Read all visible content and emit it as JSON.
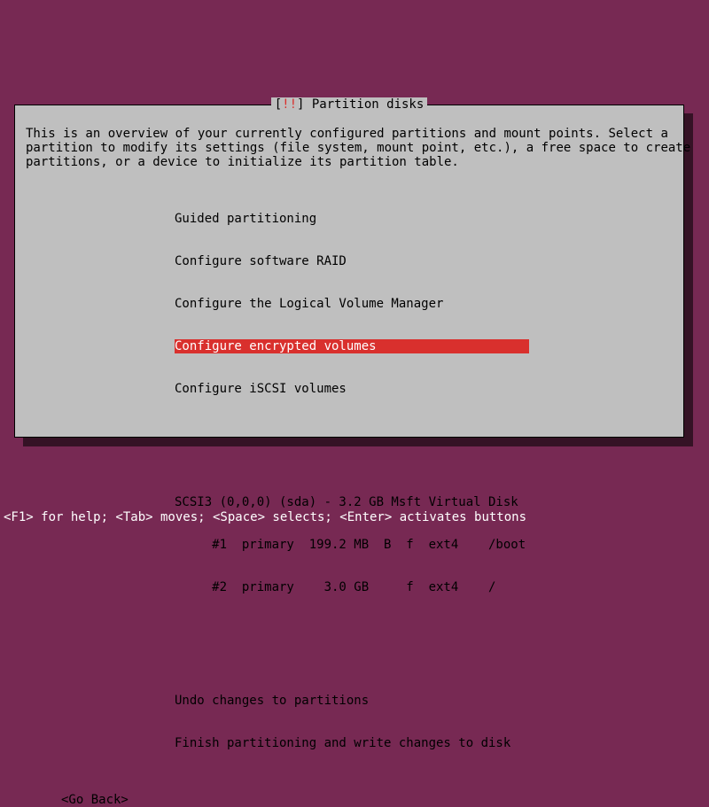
{
  "title_prefix": "[",
  "title_bang": "!!",
  "title_suffix": "] ",
  "title_text": "Partition disks",
  "description": "This is an overview of your currently configured partitions and mount points. Select a\npartition to modify its settings (file system, mount point, etc.), a free space to create\npartitions, or a device to initialize its partition table.",
  "menu": {
    "group1": [
      "Guided partitioning",
      "Configure software RAID",
      "Configure the Logical Volume Manager",
      "Configure encrypted volumes",
      "Configure iSCSI volumes"
    ],
    "selected_index": 3,
    "disk_header": "SCSI3 (0,0,0) (sda) - 3.2 GB Msft Virtual Disk",
    "partitions": [
      "     #1  primary  199.2 MB  B  f  ext4    /boot",
      "     #2  primary    3.0 GB     f  ext4    /"
    ],
    "group3": [
      "Undo changes to partitions",
      "Finish partitioning and write changes to disk"
    ]
  },
  "go_back": "<Go Back>",
  "footer": "<F1> for help; <Tab> moves; <Space> selects; <Enter> activates buttons"
}
